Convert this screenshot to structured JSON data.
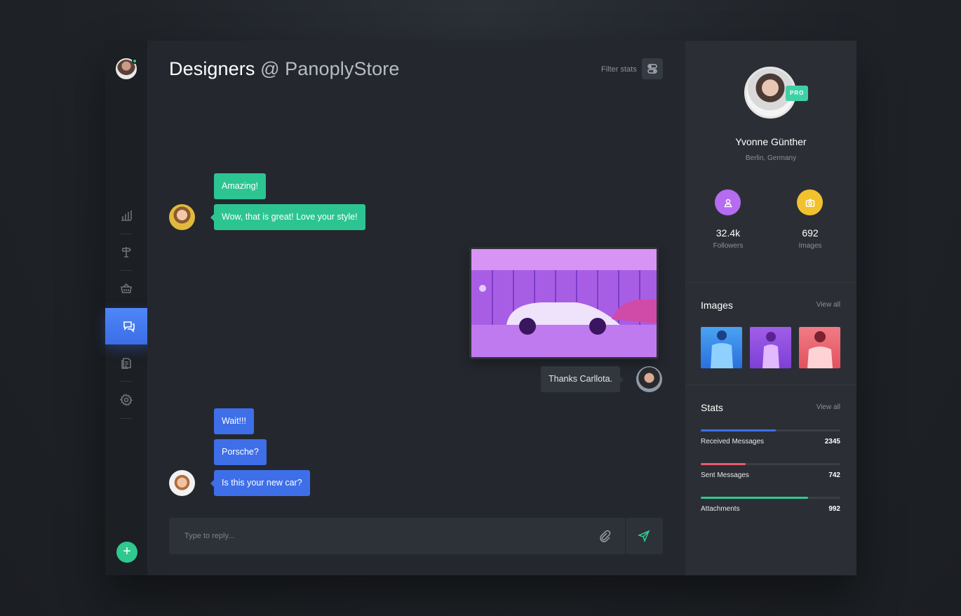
{
  "chat": {
    "title_main": "Designers",
    "title_at": "@ PanoplyStore",
    "filter_label": "Filter stats",
    "messages": [
      {
        "text": "Amazing!"
      },
      {
        "text": "Wow, that is great! Love your style!"
      },
      {
        "text": "Thanks Carllota."
      },
      {
        "text": "Wait!!!"
      },
      {
        "text": "Porsche?"
      },
      {
        "text": "Is this your new car?"
      }
    ],
    "reply_placeholder": "Type to reply..."
  },
  "sidebar": {
    "fab_label": "+"
  },
  "profile": {
    "name": "Yvonne Günther",
    "location": "Berlin, Germany",
    "badge": "PRO",
    "followers_value": "32.4k",
    "followers_label": "Followers",
    "images_value": "692",
    "images_label": "Images"
  },
  "images_section": {
    "title": "Images",
    "view_all": "View all"
  },
  "stats_section": {
    "title": "Stats",
    "view_all": "View all",
    "items": [
      {
        "label": "Received Messages",
        "value": "2345",
        "fill_fraction": 0.54,
        "color": "#3e6fe8"
      },
      {
        "label": "Sent Messages",
        "value": "742",
        "fill_fraction": 0.32,
        "color": "#ea5a6a"
      },
      {
        "label": "Attachments",
        "value": "992",
        "fill_fraction": 0.77,
        "color": "#2fc88f"
      }
    ]
  },
  "colors": {
    "accent_blue": "#3e6fe8",
    "accent_green": "#2cc592",
    "followers_icon_bg": "#b56cf0",
    "images_icon_bg": "#f2c12e"
  }
}
